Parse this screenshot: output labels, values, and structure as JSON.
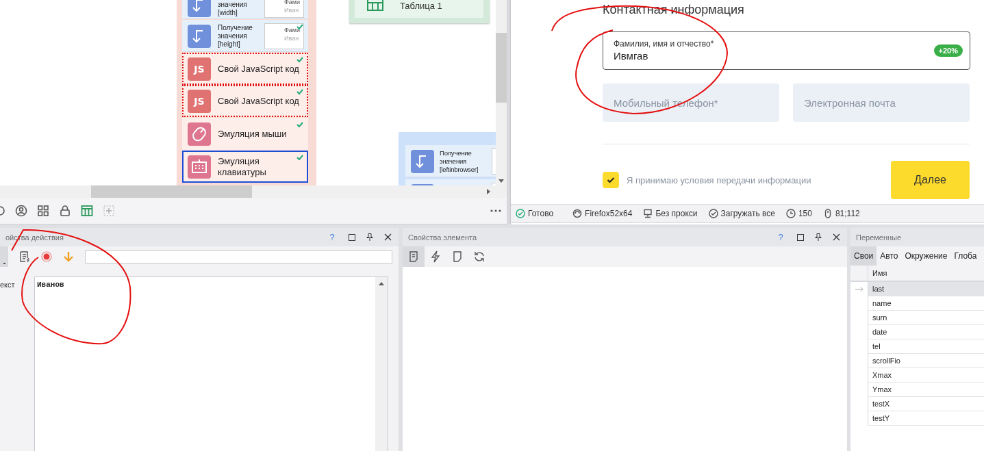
{
  "canvas": {
    "table_group": {
      "label": "Таблица 1"
    },
    "blocks": [
      {
        "kind": "get-value",
        "label": "значения [width]",
        "preview": [
          "Фами",
          "Иван"
        ],
        "done": false,
        "highlighted": false,
        "selected": false
      },
      {
        "kind": "get-value",
        "label": "Получение значения [height]",
        "preview": [
          "Фами",
          "Иван"
        ],
        "done": true,
        "highlighted": false,
        "selected": false
      },
      {
        "kind": "js",
        "icon_text": "JS",
        "label": "Свой JavaScript код",
        "done": true,
        "highlighted": true,
        "selected": false
      },
      {
        "kind": "js",
        "icon_text": "JS",
        "label": "Свой JavaScript код",
        "done": true,
        "highlighted": true,
        "selected": false
      },
      {
        "kind": "mouse",
        "label": "Эмуляция мыши",
        "done": true,
        "highlighted": false,
        "selected": false
      },
      {
        "kind": "keyboard",
        "label": "Эмуляция клавиатуры",
        "done": true,
        "highlighted": false,
        "selected": true
      }
    ],
    "side_blocks": [
      {
        "kind": "get-value",
        "label": "Получение значения [leftinbrowser]"
      },
      {
        "kind": "get-value"
      }
    ]
  },
  "browser": {
    "heading": "Контактная информация",
    "fio": {
      "label": "Фамилия, имя и отчество*",
      "value": "Ивмгав",
      "badge": "+20%"
    },
    "fields": [
      {
        "placeholder": "Мобильный телефон*"
      },
      {
        "placeholder": "Электронная почта"
      }
    ],
    "consent": {
      "label": "Я принимаю условия передачи информации",
      "checked": true
    },
    "next_button": "Далее"
  },
  "status_bar": [
    {
      "kind": "ready",
      "text": "Готово"
    },
    {
      "kind": "browser",
      "text": "Firefox52x64"
    },
    {
      "kind": "proxy",
      "text": "Без прокси"
    },
    {
      "kind": "load",
      "text": "Загружать все"
    },
    {
      "kind": "timeout",
      "text": "150"
    },
    {
      "kind": "mouse",
      "text": "81;112"
    }
  ],
  "action_panel": {
    "title": "ойства действия",
    "help": "?",
    "tools": [
      {
        "kind": "cut",
        "selected": true
      },
      {
        "kind": "script",
        "selected": false
      },
      {
        "kind": "record",
        "selected": false
      },
      {
        "kind": "down",
        "selected": false
      }
    ],
    "field_label": "екст",
    "text_value": "Иванов"
  },
  "element_panel": {
    "title": "Свойства элемента",
    "help": "?",
    "tools": [
      {
        "kind": "doc",
        "selected": true
      },
      {
        "kind": "bolt",
        "selected": false
      },
      {
        "kind": "page",
        "selected": false
      },
      {
        "kind": "refresh",
        "selected": false
      }
    ]
  },
  "variables": {
    "title": "Переменные",
    "tabs": [
      {
        "label": "Свои",
        "selected": true
      },
      {
        "label": "Авто",
        "selected": false
      },
      {
        "label": "Окружение",
        "selected": false
      },
      {
        "label": "Глоба",
        "selected": false
      }
    ],
    "column": "Имя",
    "rows": [
      {
        "name": "last",
        "selected": true
      },
      {
        "name": "name",
        "selected": false
      },
      {
        "name": "surn",
        "selected": false
      },
      {
        "name": "date",
        "selected": false
      },
      {
        "name": "tel",
        "selected": false
      },
      {
        "name": "scrollFio",
        "selected": false
      },
      {
        "name": "Xmax",
        "selected": false
      },
      {
        "name": "Ymax",
        "selected": false
      },
      {
        "name": "testX",
        "selected": false
      },
      {
        "name": "testY",
        "selected": false
      }
    ]
  }
}
